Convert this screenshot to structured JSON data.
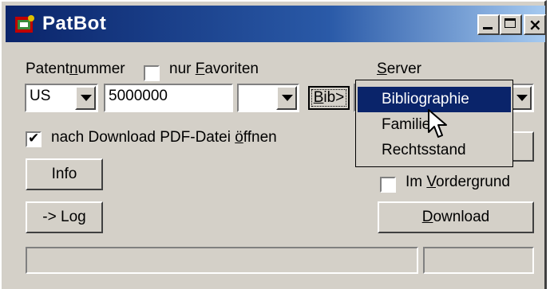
{
  "window": {
    "title": "PatBot"
  },
  "labels": {
    "patentnummer_pre": "Patent",
    "patentnummer_u": "n",
    "patentnummer_post": "ummer",
    "nur_favoriten_pre": "nur ",
    "nur_favoriten_u": "F",
    "nur_favoriten_post": "avoriten",
    "server_u": "S",
    "server_post": "erver",
    "pdf_pre": "nach Download PDF-Datei ",
    "pdf_u": "ö",
    "pdf_post": "ffnen",
    "vordergrund_pre": "Im ",
    "vordergrund_u": "V",
    "vordergrund_post": "ordergrund"
  },
  "fields": {
    "country": "US",
    "number": "5000000",
    "kind": ""
  },
  "buttons": {
    "bib_u": "B",
    "bib_post": "ib>",
    "info": "Info",
    "log": "-> Log",
    "download_u": "D",
    "download_post": "ownload"
  },
  "checkboxes": {
    "nur_favoriten": false,
    "pdf_oeffnen": true,
    "im_vordergrund": false
  },
  "server_menu": {
    "items": [
      "Bibliographie",
      "Familie",
      "Rechtsstand"
    ],
    "selected": "Bibliographie"
  },
  "icons": [
    "app-icon",
    "minimize-icon",
    "maximize-icon",
    "close-icon",
    "dropdown-arrow-icon",
    "mouse-cursor-icon"
  ]
}
